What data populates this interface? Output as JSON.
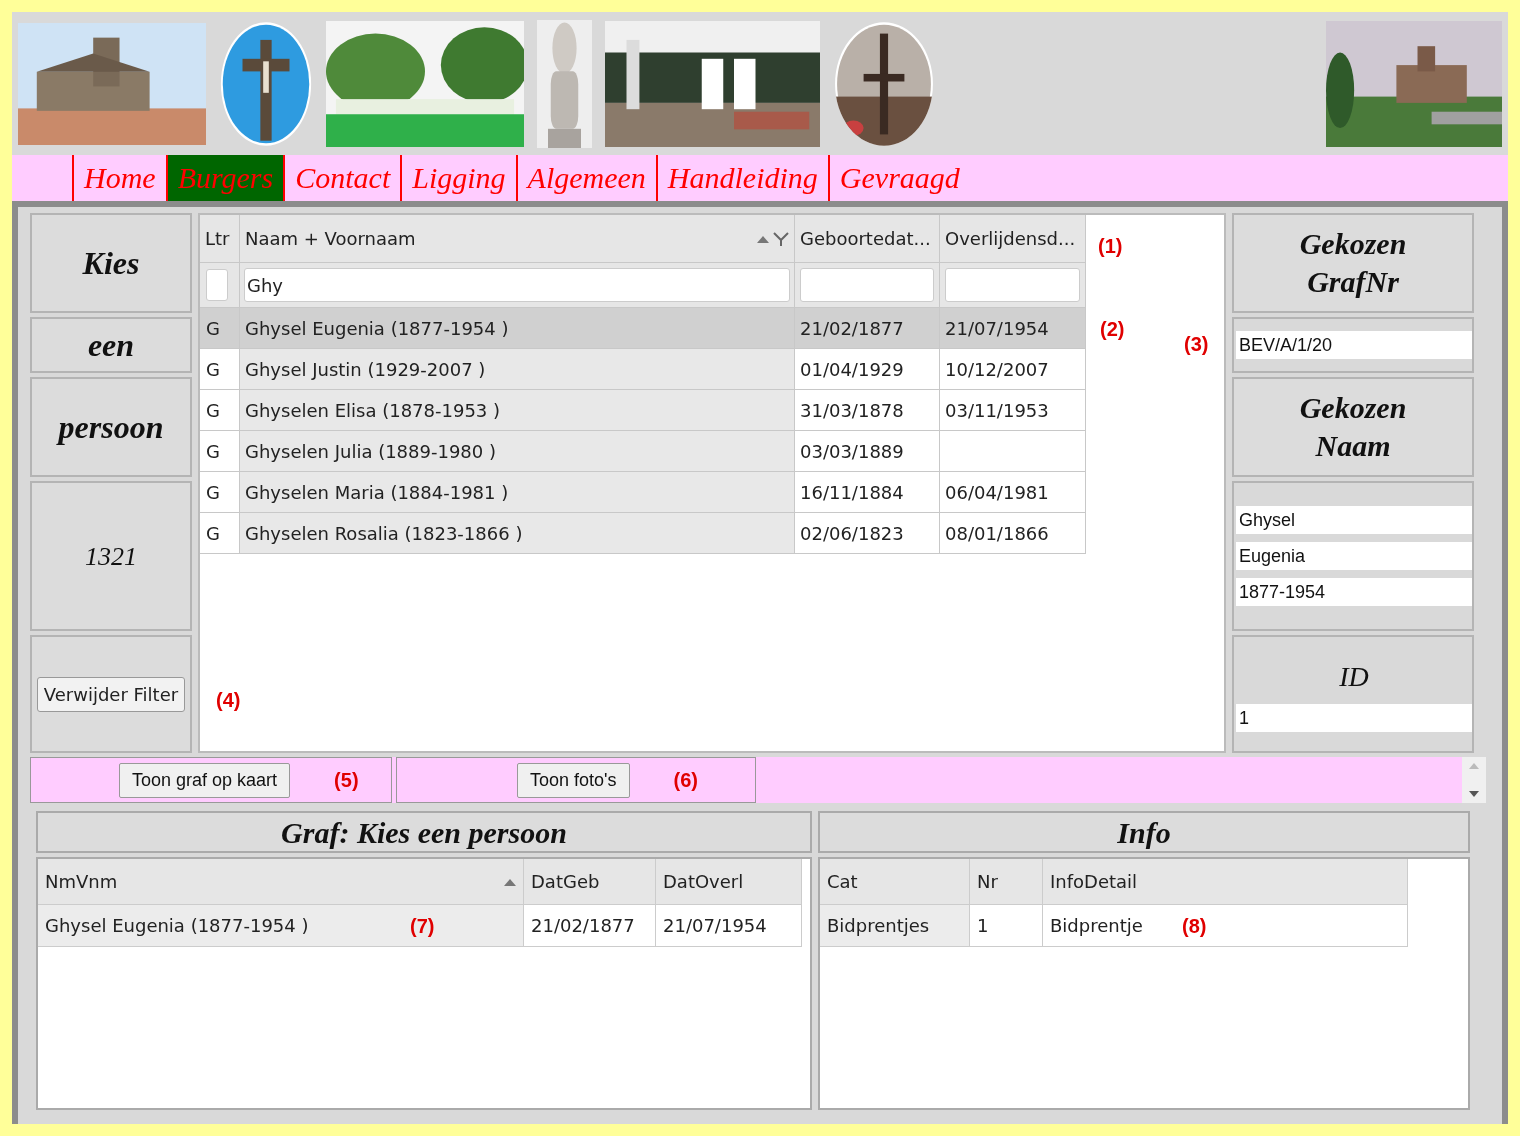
{
  "nav": [
    {
      "label": "Home",
      "selected": false
    },
    {
      "label": "Burgers",
      "selected": true
    },
    {
      "label": "Contact",
      "selected": false
    },
    {
      "label": "Ligging",
      "selected": false
    },
    {
      "label": "Algemeen",
      "selected": false
    },
    {
      "label": "Handleiding",
      "selected": false
    },
    {
      "label": "Gevraagd",
      "selected": false
    }
  ],
  "side_labels": [
    "Kies",
    "een",
    "persoon",
    "1321"
  ],
  "remove_filter_button": "Verwijder Filter",
  "remove_filter_annotation": "(4)",
  "table": {
    "columns": [
      "Ltr",
      "Naam + Voornaam",
      "Geboortedat...",
      "Overlijdensd..."
    ],
    "name_filter": "Ghy",
    "header_annotation": "(1)",
    "rows": [
      {
        "ltr": "G",
        "name": "Ghysel Eugenia (1877-1954 )",
        "born": "21/02/1877",
        "died": "21/07/1954",
        "selected": true,
        "annotation": "(2)"
      },
      {
        "ltr": "G",
        "name": "Ghysel Justin (1929-2007 )",
        "born": "01/04/1929",
        "died": "10/12/2007",
        "selected": false
      },
      {
        "ltr": "G",
        "name": "Ghyselen Elisa (1878-1953 )",
        "born": "31/03/1878",
        "died": "03/11/1953",
        "selected": false
      },
      {
        "ltr": "G",
        "name": "Ghyselen Julia (1889-1980 )",
        "born": "03/03/1889",
        "selected": false
      },
      {
        "ltr": "G",
        "name": "Ghyselen Maria (1884-1981 )",
        "born": "16/11/1884",
        "died": "06/04/1981",
        "selected": false
      },
      {
        "ltr": "G",
        "name": "Ghyselen Rosalia (1823-1866 )",
        "born": "02/06/1823",
        "died": "08/01/1866",
        "selected": false
      }
    ]
  },
  "right": {
    "grafnr_label": [
      "Gekozen",
      "GrafNr"
    ],
    "grafnr_value": "BEV/A/1/20",
    "annotation": "(3)",
    "naam_label": [
      "Gekozen",
      "Naam"
    ],
    "naam_values": [
      "Ghysel",
      "Eugenia",
      "1877-1954"
    ],
    "id_label": "ID",
    "id_value": "1"
  },
  "actions": [
    {
      "label": "Toon graf op kaart",
      "annotation": "(5)"
    },
    {
      "label": "Toon foto's",
      "annotation": "(6)"
    }
  ],
  "grave_panel": {
    "title": "Graf: Kies een persoon",
    "columns": [
      "NmVnm",
      "DatGeb",
      "DatOverl"
    ],
    "rows": [
      {
        "cells": [
          "Ghysel Eugenia (1877-1954 )",
          "21/02/1877",
          "21/07/1954"
        ],
        "annotation": "(7)"
      }
    ]
  },
  "info_panel": {
    "title": "Info",
    "columns": [
      "Cat",
      "Nr",
      "InfoDetail"
    ],
    "rows": [
      {
        "cells": [
          "Bidprentjes",
          "1",
          "Bidprentje"
        ],
        "annotation": "(8)"
      }
    ]
  }
}
